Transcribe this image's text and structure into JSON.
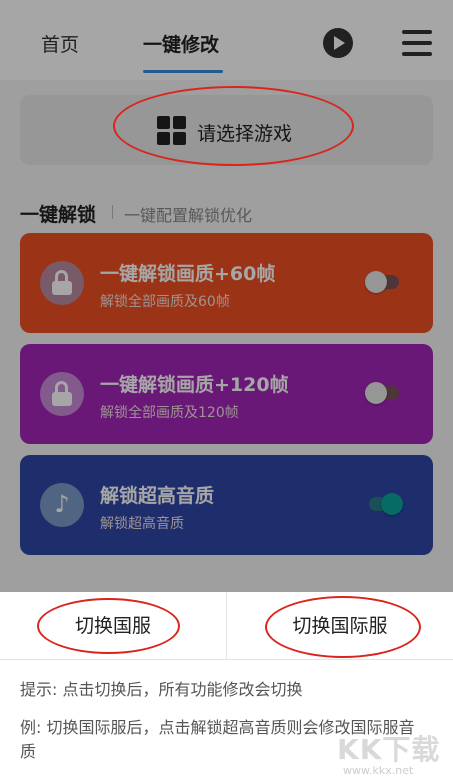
{
  "header": {
    "tabs": [
      {
        "label": "首页"
      },
      {
        "label": "一键修改"
      }
    ]
  },
  "select_game": {
    "label": "请选择游戏"
  },
  "section": {
    "title": "一键解锁",
    "subtitle": "一键配置解锁优化"
  },
  "cards": [
    {
      "title": "一键解锁画质+60帧",
      "desc": "解锁全部画质及60帧",
      "icon": "lock-open-icon",
      "enabled": false,
      "color": "#ef5024"
    },
    {
      "title": "一键解锁画质+120帧",
      "desc": "解锁全部画质及120帧",
      "icon": "lock-open-icon",
      "enabled": false,
      "color": "#a425b8"
    },
    {
      "title": "解锁超高音质",
      "desc": "解锁超高音质",
      "icon": "music-note-icon",
      "enabled": true,
      "color": "#2f45a6"
    }
  ],
  "sheet": {
    "btn_cn": "切换国服",
    "btn_intl": "切换国际服",
    "tip1": "提示: 点击切换后，所有功能修改会切换",
    "tip2": "例: 切换国际服后，点击解锁超高音质则会修改国际服音质"
  },
  "watermark": {
    "main": "KK下载",
    "url": "www.kkx.net"
  }
}
